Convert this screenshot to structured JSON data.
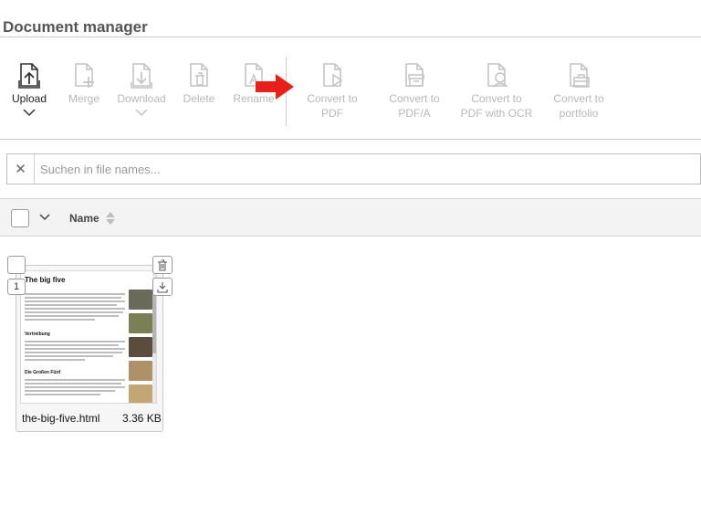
{
  "page": {
    "title": "Document manager"
  },
  "toolbar": {
    "upload": "Upload",
    "merge": "Merge",
    "download": "Download",
    "delete": "Delete",
    "rename": "Rename",
    "convert_pdf_1": "Convert to",
    "convert_pdf_2": "PDF",
    "convert_pdfa_1": "Convert to",
    "convert_pdfa_2": "PDF/A",
    "convert_ocr_1": "Convert to",
    "convert_ocr_2": "PDF with OCR",
    "convert_portfolio_1": "Convert to",
    "convert_portfolio_2": "portfolio"
  },
  "search": {
    "placeholder": "Suchen in file names...",
    "value": ""
  },
  "table": {
    "column_name": "Name"
  },
  "files": [
    {
      "name": "the-big-five.html",
      "size": "3.36 KB",
      "index": "1",
      "thumbnail": {
        "title": "The big five",
        "heading_1": "Vertreibung",
        "heading_2": "Die Großen Fünf"
      }
    }
  ],
  "colors": {
    "arrow": "#e8201c",
    "disabled_text": "#b8b8b8",
    "active_text": "#222222"
  }
}
